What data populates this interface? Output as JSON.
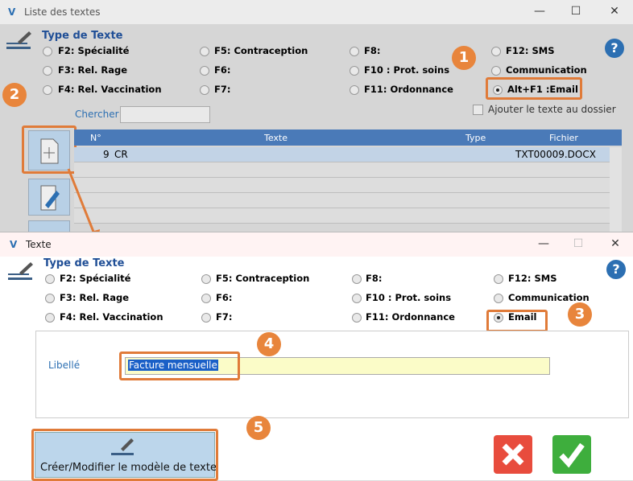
{
  "bg": {
    "title": "Liste des  textes",
    "section_title": "Type de Texte",
    "options": [
      "F2: Spécialité",
      "F5: Contraception",
      "F8:",
      "F12: SMS",
      "F3: Rel. Rage",
      "F6:",
      "F10 : Prot. soins",
      "Communication",
      "F4: Rel. Vaccination",
      "F7:",
      "F11: Ordonnance",
      "Alt+F1 :Email"
    ],
    "search_label": "Chercher",
    "add_to_folder": "Ajouter le texte au dossier",
    "columns": [
      "N°",
      "Texte",
      "Type",
      "Fichier"
    ],
    "row": {
      "num": "9",
      "texte": "CR",
      "type": "",
      "fichier": "TXT00009.DOCX"
    }
  },
  "dlg": {
    "title": "Texte",
    "section_title": "Type de Texte",
    "options": [
      "F2: Spécialité",
      "F5: Contraception",
      "F8:",
      "F12: SMS",
      "F3: Rel. Rage",
      "F6:",
      "F10 : Prot. soins",
      "Communication",
      "F4: Rel. Vaccination",
      "F7:",
      "F11: Ordonnance",
      "Email"
    ],
    "libelle_label": "Libellé",
    "libelle_value": "Facture mensuelle",
    "create_button": "Créer/Modifier le modèle de texte"
  },
  "steps": [
    "1",
    "2",
    "3",
    "4",
    "5"
  ],
  "colors": {
    "accent": "#e8853c",
    "header": "#1f4e96",
    "grid": "#4a7ab8"
  }
}
